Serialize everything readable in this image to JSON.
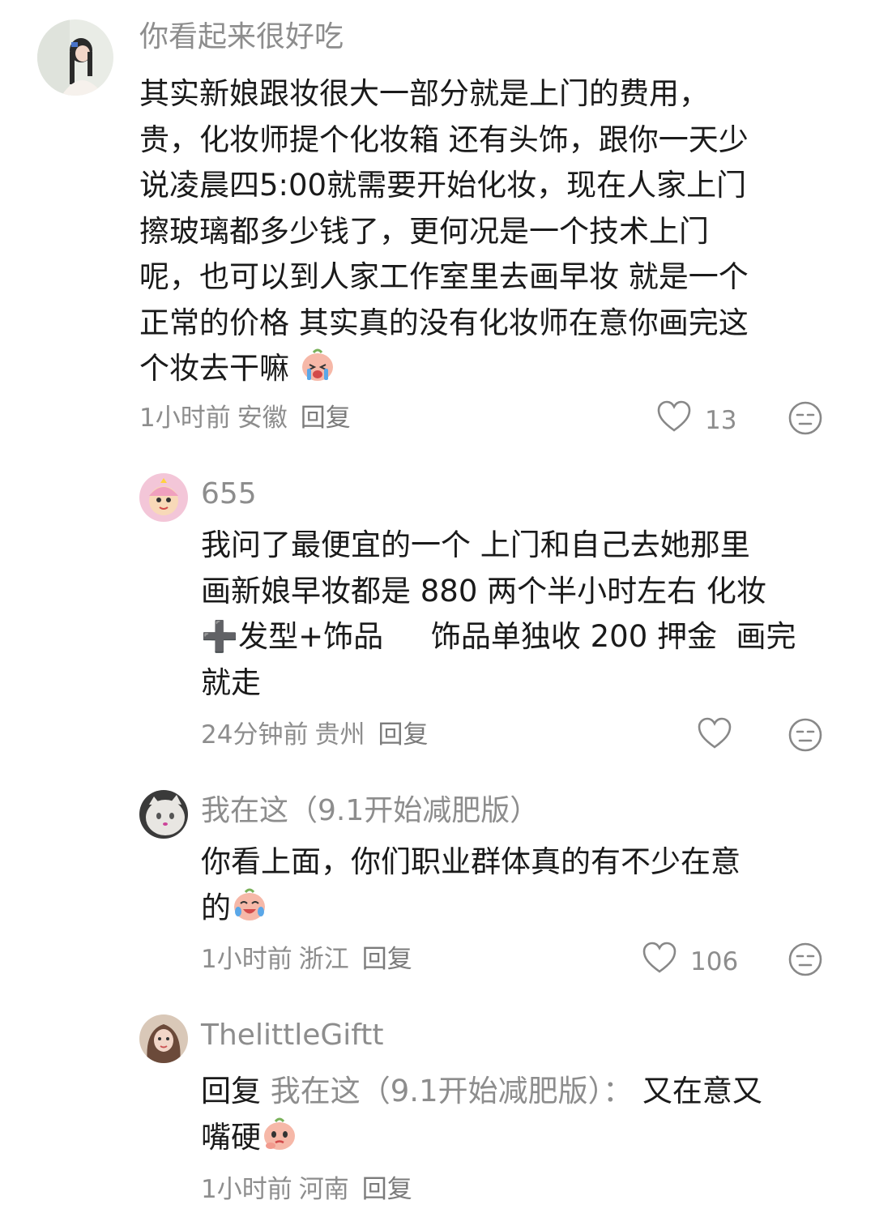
{
  "comments": [
    {
      "username": "你看起来很好吃",
      "lines": [
        "其实新娘跟妆很大一部分就是上门的费用，",
        "贵，化妆师提个化妆箱 还有头饰，跟你一天少",
        "说凌晨四5:00就需要开始化妆，现在人家上门",
        "擦玻璃都多少钱了，更何况是一个技术上门",
        "呢，也可以到人家工作室里去画早妆 就是一个",
        "正常的价格 其实真的没有化妆师在意你画完这",
        "个妆去干嘛"
      ],
      "time": "1小时前",
      "location": "安徽",
      "reply_label": "回复",
      "likes": "13"
    },
    {
      "username": "655",
      "lines": [
        "我问了最便宜的一个 上门和自己去她那里",
        "画新娘早妆都是 880 两个半小时左右 化妆",
        "➕发型+饰品     饰品单独收 200 押金  画完",
        "就走"
      ],
      "time": "24分钟前",
      "location": "贵州",
      "reply_label": "回复"
    },
    {
      "username": "我在这（9.1开始减肥版）",
      "lines": [
        "你看上面，你们职业群体真的有不少在意",
        "的"
      ],
      "time": "1小时前",
      "location": "浙江",
      "reply_label": "回复",
      "likes": "106"
    },
    {
      "username": "ThelittleGiftt",
      "reply_prefix": "回复",
      "reply_to": "我在这（9.1开始减肥版）：",
      "lines": [
        "又在意又",
        "嘴硬"
      ],
      "time": "1小时前",
      "location": "河南",
      "reply_label": "回复"
    }
  ],
  "colors": {
    "text": "#1a1a1a",
    "muted": "#8d8d8d"
  }
}
